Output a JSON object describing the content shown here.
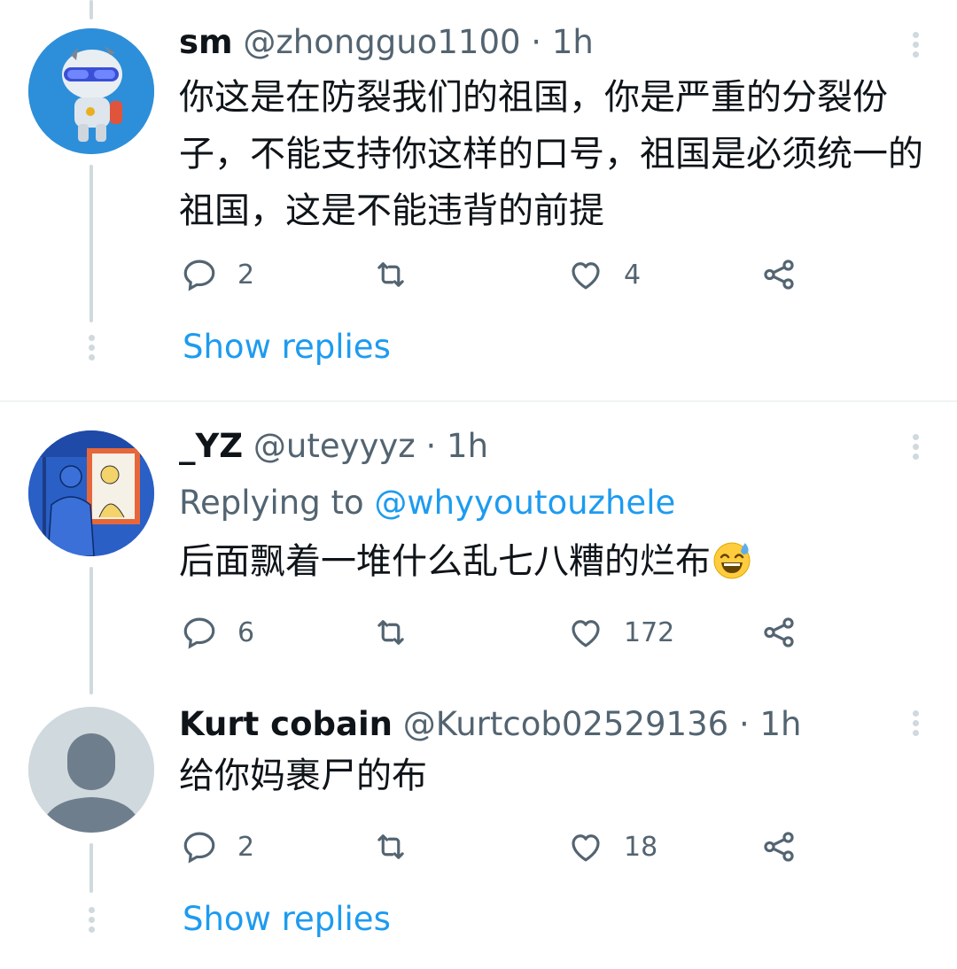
{
  "tweets": [
    {
      "name": "sm",
      "handle": "@zhongguo1100",
      "time": "· 1h",
      "avatar_icon": "robot-avatar",
      "text": "你这是在防裂我们的祖国，你是严重的分裂份子，不能支持你这样的口号，祖国是必须统一的祖国，这是不能违背的前提",
      "replies": "2",
      "likes": "4",
      "show_replies": "Show replies"
    },
    {
      "name": "_YZ",
      "handle": "@uteyyyz",
      "time": "· 1h",
      "avatar_icon": "mirror-illustration-avatar",
      "replying_label": "Replying to",
      "replying_handle": "@whyyoutouzhele",
      "text": "后面飘着一堆什么乱七八糟的烂布",
      "emoji": "sweat-smile-emoji",
      "replies": "6",
      "likes": "172"
    },
    {
      "name": "Kurt cobain",
      "handle": "@Kurtcob02529136",
      "time": "· 1h",
      "avatar_icon": "default-profile-avatar",
      "text": "给你妈裹尸的布",
      "replies": "2",
      "likes": "18",
      "show_replies": "Show replies"
    }
  ],
  "colors": {
    "accent": "#1d9bf0",
    "secondary_text": "#536471",
    "thread_line": "#cfd9de"
  }
}
